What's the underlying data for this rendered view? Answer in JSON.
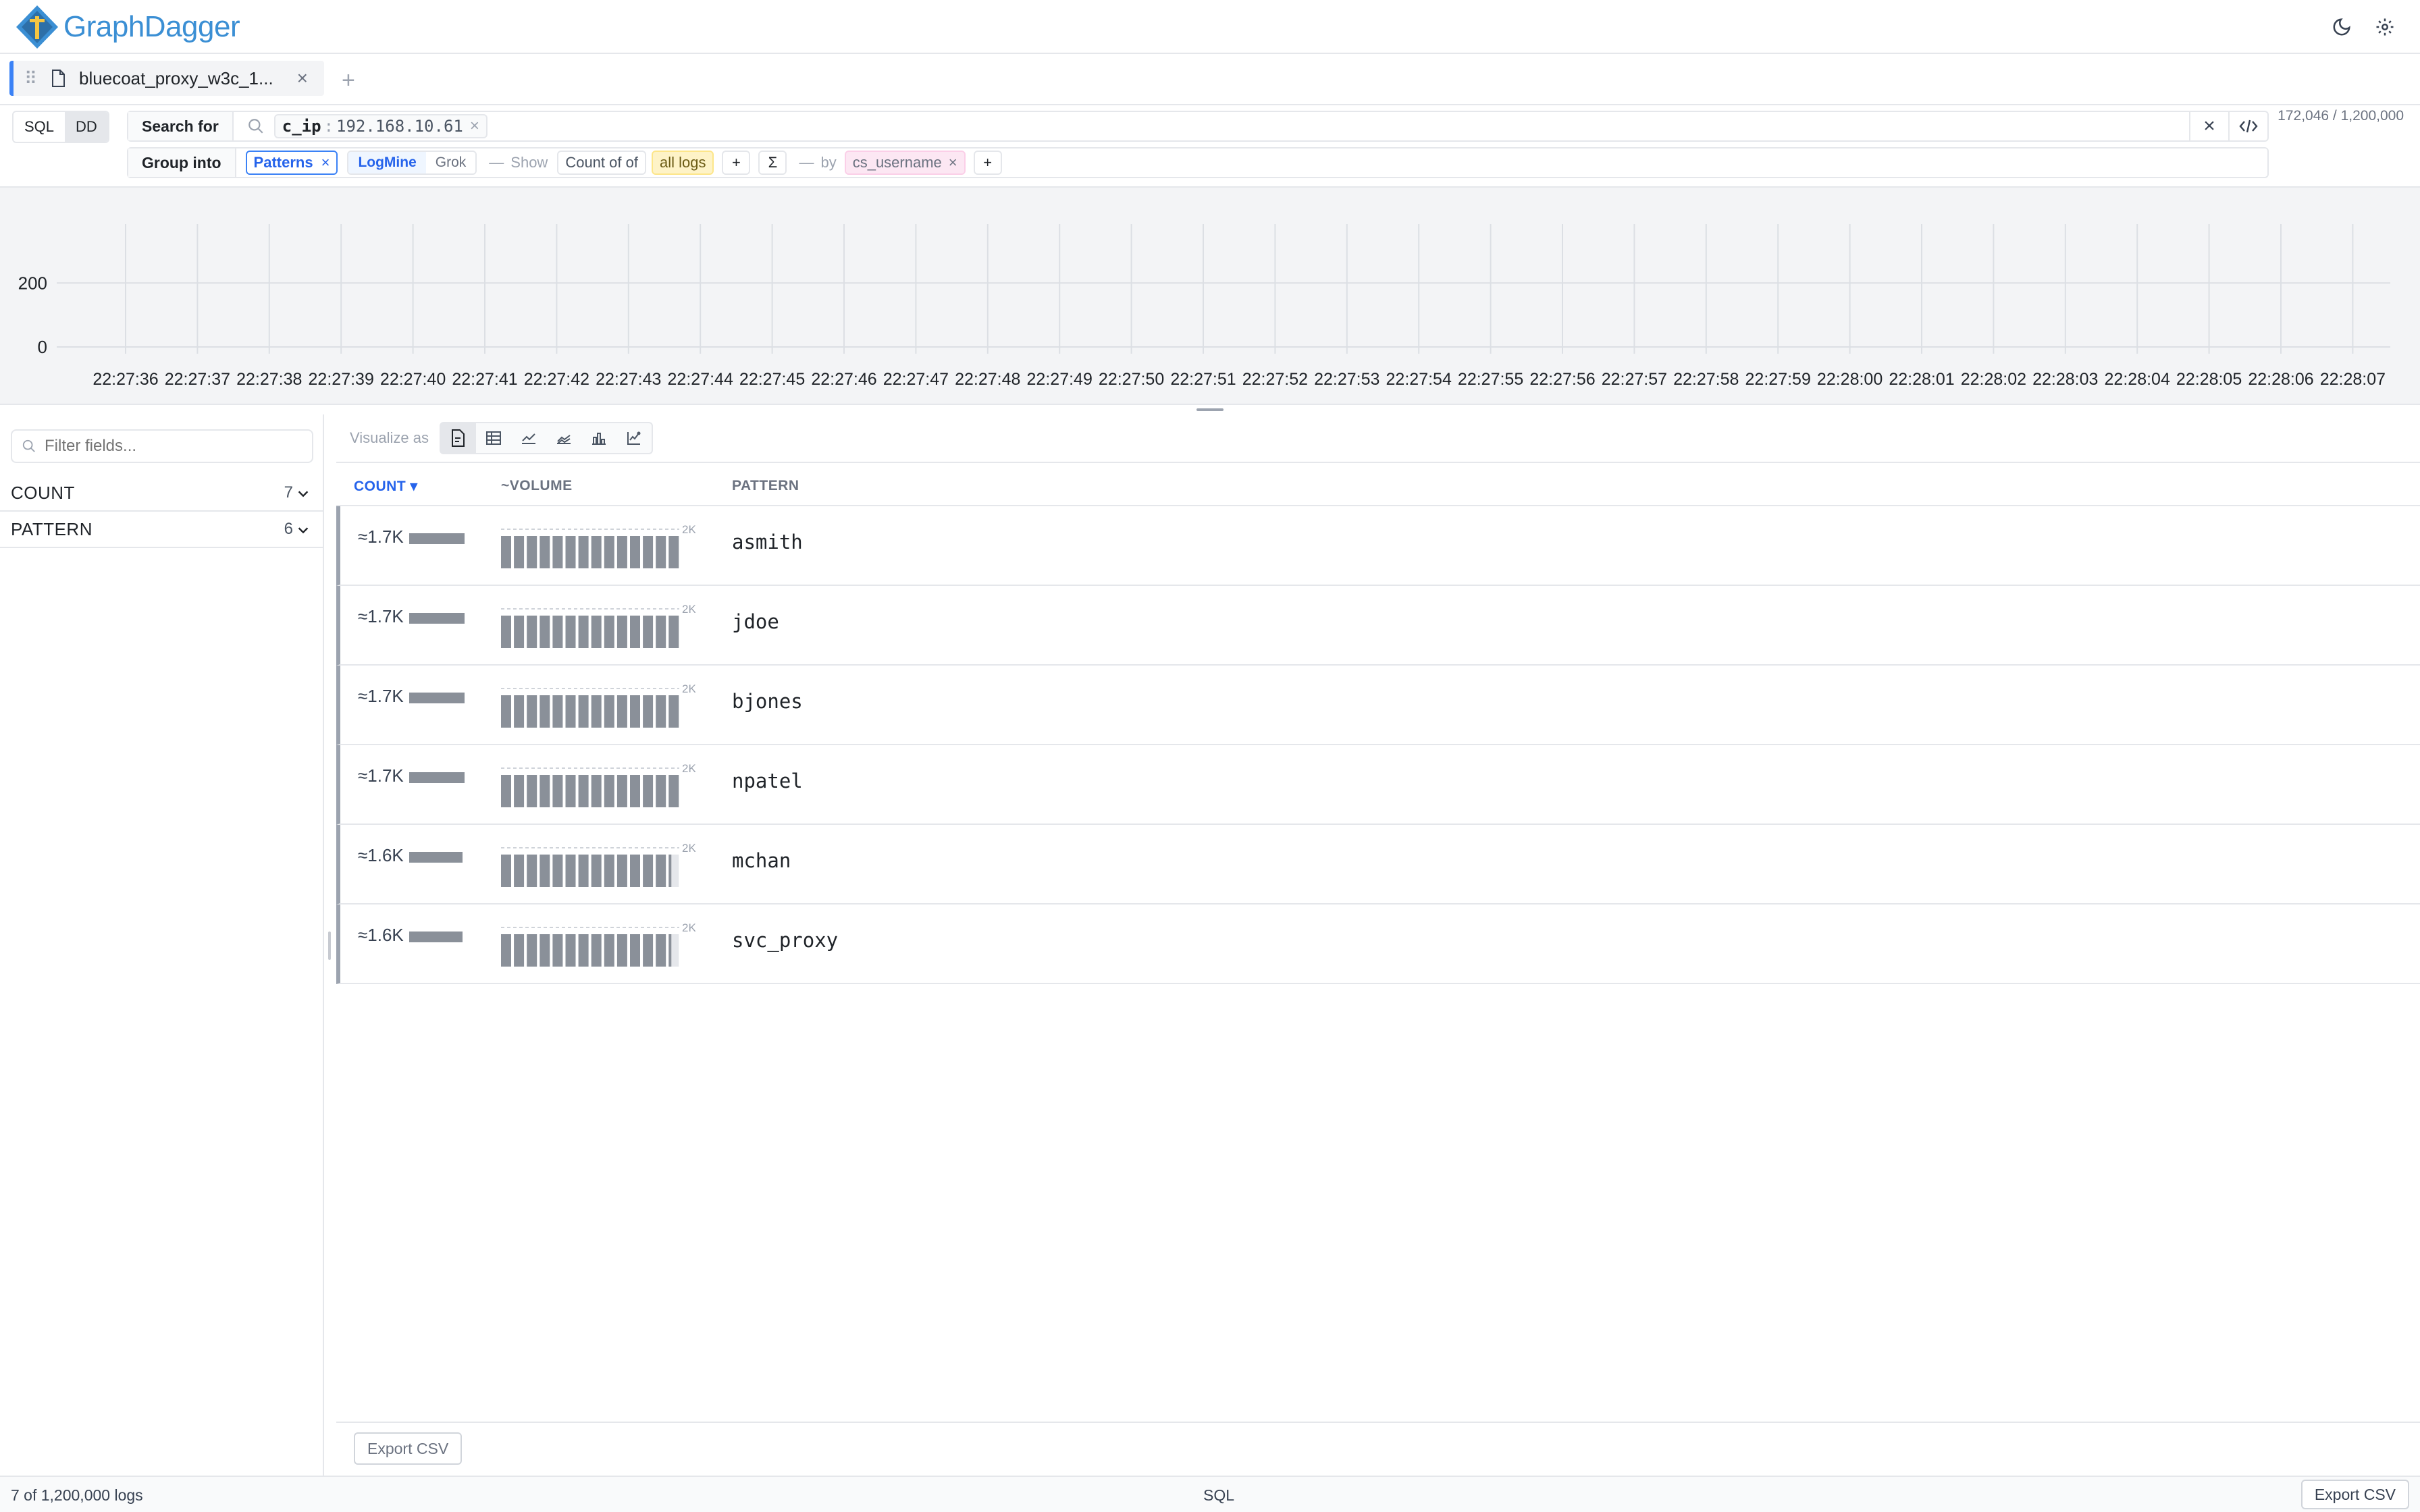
{
  "app": {
    "name": "GraphDagger"
  },
  "tab": {
    "label": "bluecoat_proxy_w3c_1...",
    "add": "+"
  },
  "mode": {
    "sql": "SQL",
    "dd": "DD"
  },
  "search": {
    "label": "Search for",
    "filter_key": "c_ip",
    "filter_sep": ":",
    "filter_value": "192.168.10.61"
  },
  "group": {
    "label": "Group into",
    "patterns_chip": "Patterns",
    "miners": [
      "LogMine",
      "Grok"
    ],
    "show_label": "Show",
    "agg": "Count of of",
    "scope": "all logs",
    "plus": "+",
    "sigma": "Σ",
    "by_label": "by",
    "by_field": "cs_username"
  },
  "row_count": "172,046 / 1,200,000",
  "chart_data": {
    "type": "bar",
    "x": [
      "22:27:36",
      "22:27:37",
      "22:27:38",
      "22:27:39",
      "22:27:40",
      "22:27:41",
      "22:27:42",
      "22:27:43",
      "22:27:44",
      "22:27:45",
      "22:27:46",
      "22:27:47",
      "22:27:48",
      "22:27:49",
      "22:27:50",
      "22:27:51",
      "22:27:52",
      "22:27:53",
      "22:27:54",
      "22:27:55",
      "22:27:56",
      "22:27:57",
      "22:27:58",
      "22:27:59",
      "22:28:00",
      "22:28:01",
      "22:28:02",
      "22:28:03",
      "22:28:04",
      "22:28:05",
      "22:28:06",
      "22:28:07"
    ],
    "yticks": [
      0,
      200
    ],
    "ylim": [
      0,
      380
    ],
    "grid": true
  },
  "fields": {
    "filter_placeholder": "Filter fields...",
    "items": [
      {
        "name": "COUNT",
        "count": "7"
      },
      {
        "name": "PATTERN",
        "count": "6"
      }
    ]
  },
  "viz": {
    "label": "Visualize as"
  },
  "table": {
    "headers": {
      "count": "COUNT ▾",
      "volume": "~VOLUME",
      "pattern": "PATTERN"
    },
    "volume_max_label": "2K",
    "rows": [
      {
        "count": "≈1.7K",
        "count_fraction": 0.95,
        "pattern": "asmith",
        "volume_fraction": 1.0
      },
      {
        "count": "≈1.7K",
        "count_fraction": 0.95,
        "pattern": "jdoe",
        "volume_fraction": 1.0
      },
      {
        "count": "≈1.7K",
        "count_fraction": 0.95,
        "pattern": "bjones",
        "volume_fraction": 1.0
      },
      {
        "count": "≈1.7K",
        "count_fraction": 0.95,
        "pattern": "npatel",
        "volume_fraction": 1.0
      },
      {
        "count": "≈1.6K",
        "count_fraction": 0.92,
        "pattern": "mchan",
        "volume_fraction": 0.94
      },
      {
        "count": "≈1.6K",
        "count_fraction": 0.92,
        "pattern": "svc_proxy",
        "volume_fraction": 0.94
      }
    ],
    "export": "Export CSV"
  },
  "status": {
    "logs": "7 of 1,200,000 logs",
    "lang": "SQL",
    "export": "Export CSV"
  },
  "colors": {
    "accent": "#3b8fd4",
    "link": "#2563eb",
    "bar": "#8a9099",
    "scope_chip": "#fef3c7",
    "by_chip": "#fce7f3"
  }
}
